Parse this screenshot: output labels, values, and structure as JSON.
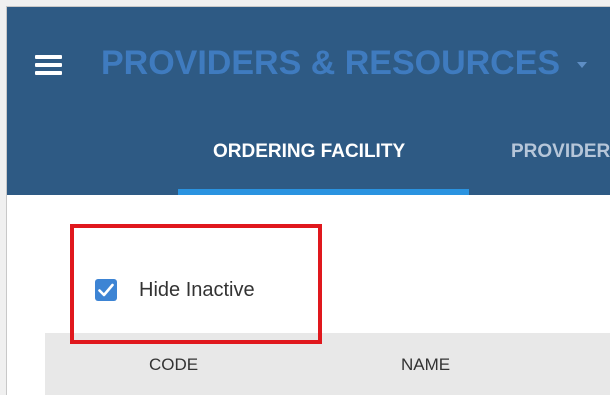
{
  "header": {
    "title": "PROVIDERS & RESOURCES",
    "menu_icon": "hamburger-menu-icon",
    "dropdown_icon": "caret-down-icon",
    "background_color": "#2e5a84",
    "title_color": "#3f7bbf"
  },
  "tabs": [
    {
      "label": "ORDERING FACILITY",
      "active": true
    },
    {
      "label": "PROVIDER"
    }
  ],
  "accent_color": "#2a93e0",
  "filters": {
    "hide_inactive_label": "Hide Inactive",
    "hide_inactive_checked": true
  },
  "table": {
    "columns": [
      "CODE",
      "NAME"
    ]
  },
  "annotation": {
    "highlight_color": "#e0181d"
  }
}
